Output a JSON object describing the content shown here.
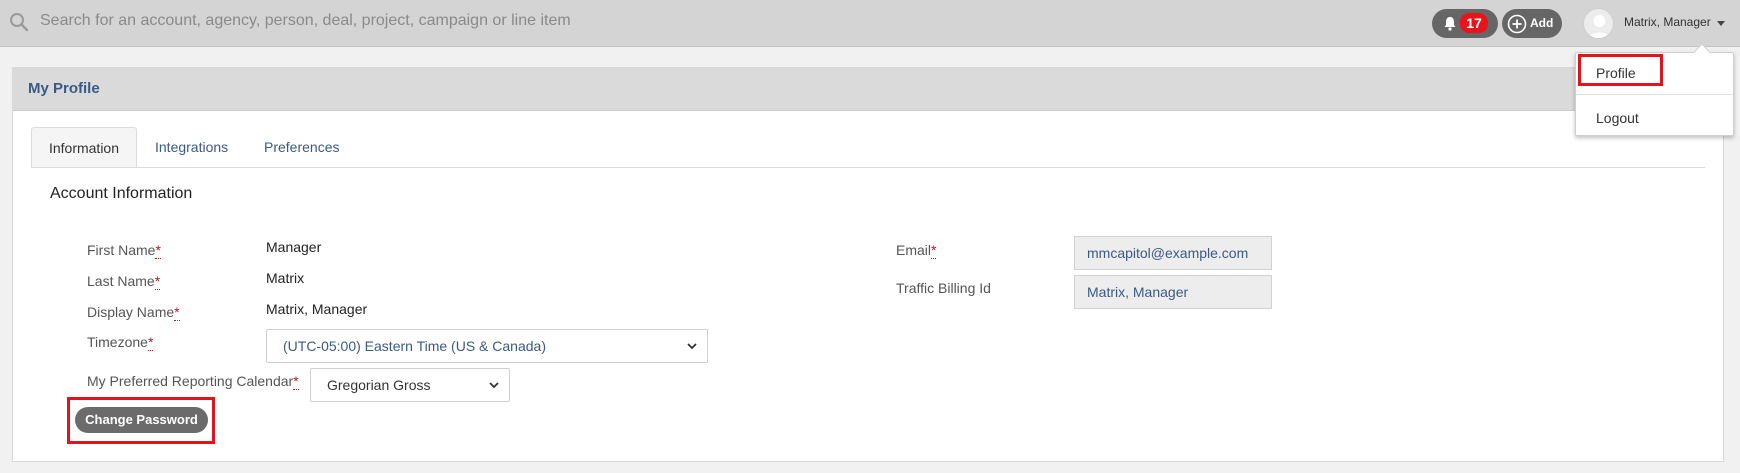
{
  "topbar": {
    "search_placeholder": "Search for an account, agency, person, deal, project, campaign or line item",
    "notification_count": "17",
    "add_label": "Add",
    "user_name": "Matrix, Manager"
  },
  "user_menu": {
    "items": [
      {
        "label": "Profile",
        "highlighted": true
      },
      {
        "label": "Logout"
      }
    ]
  },
  "page": {
    "title": "My Profile",
    "tabs": [
      {
        "label": "Information",
        "active": true
      },
      {
        "label": "Integrations"
      },
      {
        "label": "Preferences"
      }
    ],
    "section_title": "Account Information"
  },
  "form": {
    "first_name_label": "First Name",
    "first_name_value": "Manager",
    "last_name_label": "Last Name",
    "last_name_value": "Matrix",
    "display_name_label": "Display Name",
    "display_name_value": "Matrix, Manager",
    "timezone_label": "Timezone",
    "timezone_value": "(UTC-05:00) Eastern Time (US & Canada)",
    "calendar_label": "My Preferred Reporting Calendar",
    "calendar_value": "Gregorian Gross",
    "email_label": "Email",
    "email_value": "mmcapitol@example.com",
    "billing_label": "Traffic Billing Id",
    "billing_value": "Matrix, Manager",
    "required_marker": "*",
    "change_password_label": "Change Password"
  },
  "colors": {
    "accent": "#3a5a86",
    "highlight": "#e3131c",
    "badge": "#e8141c"
  }
}
